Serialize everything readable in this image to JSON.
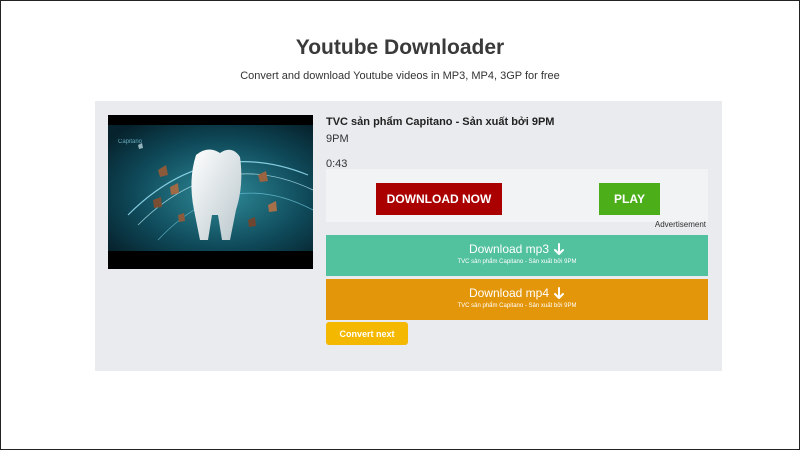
{
  "header": {
    "title": "Youtube Downloader",
    "subtitle": "Convert and download Youtube videos in MP3, MP4, 3GP for free"
  },
  "video": {
    "title": "TVC sản phẩm Capitano - Sản xuất bởi 9PM",
    "channel": "9PM",
    "duration": "0:43"
  },
  "actions": {
    "download_now": "DOWNLOAD NOW",
    "play": "PLAY",
    "advertisement": "Advertisement"
  },
  "downloads": [
    {
      "label": "Download mp3",
      "subtitle": "TVC sản phẩm Capitano - Sản xuất bởi 9PM",
      "icon": "arrow-down-icon",
      "color": "#52c19d"
    },
    {
      "label": "Download mp4",
      "subtitle": "TVC sản phẩm Capitano - Sản xuất bởi 9PM",
      "icon": "arrow-down-icon",
      "color": "#e4960a"
    }
  ],
  "convert_next": "Convert next",
  "colors": {
    "download_now": "#aa0000",
    "play": "#4caf1a",
    "convert_next": "#f5b800",
    "panel": "#e9ebee"
  }
}
